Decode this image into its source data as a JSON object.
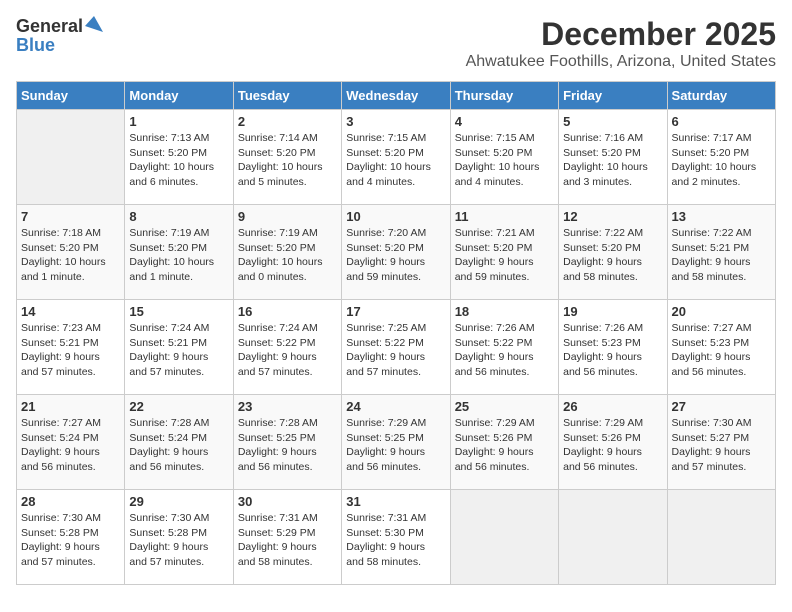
{
  "logo": {
    "general": "General",
    "blue": "Blue"
  },
  "header": {
    "month": "December 2025",
    "location": "Ahwatukee Foothills, Arizona, United States"
  },
  "weekdays": [
    "Sunday",
    "Monday",
    "Tuesday",
    "Wednesday",
    "Thursday",
    "Friday",
    "Saturday"
  ],
  "weeks": [
    [
      {
        "day": "",
        "info": ""
      },
      {
        "day": "1",
        "info": "Sunrise: 7:13 AM\nSunset: 5:20 PM\nDaylight: 10 hours\nand 6 minutes."
      },
      {
        "day": "2",
        "info": "Sunrise: 7:14 AM\nSunset: 5:20 PM\nDaylight: 10 hours\nand 5 minutes."
      },
      {
        "day": "3",
        "info": "Sunrise: 7:15 AM\nSunset: 5:20 PM\nDaylight: 10 hours\nand 4 minutes."
      },
      {
        "day": "4",
        "info": "Sunrise: 7:15 AM\nSunset: 5:20 PM\nDaylight: 10 hours\nand 4 minutes."
      },
      {
        "day": "5",
        "info": "Sunrise: 7:16 AM\nSunset: 5:20 PM\nDaylight: 10 hours\nand 3 minutes."
      },
      {
        "day": "6",
        "info": "Sunrise: 7:17 AM\nSunset: 5:20 PM\nDaylight: 10 hours\nand 2 minutes."
      }
    ],
    [
      {
        "day": "7",
        "info": "Sunrise: 7:18 AM\nSunset: 5:20 PM\nDaylight: 10 hours\nand 1 minute."
      },
      {
        "day": "8",
        "info": "Sunrise: 7:19 AM\nSunset: 5:20 PM\nDaylight: 10 hours\nand 1 minute."
      },
      {
        "day": "9",
        "info": "Sunrise: 7:19 AM\nSunset: 5:20 PM\nDaylight: 10 hours\nand 0 minutes."
      },
      {
        "day": "10",
        "info": "Sunrise: 7:20 AM\nSunset: 5:20 PM\nDaylight: 9 hours\nand 59 minutes."
      },
      {
        "day": "11",
        "info": "Sunrise: 7:21 AM\nSunset: 5:20 PM\nDaylight: 9 hours\nand 59 minutes."
      },
      {
        "day": "12",
        "info": "Sunrise: 7:22 AM\nSunset: 5:20 PM\nDaylight: 9 hours\nand 58 minutes."
      },
      {
        "day": "13",
        "info": "Sunrise: 7:22 AM\nSunset: 5:21 PM\nDaylight: 9 hours\nand 58 minutes."
      }
    ],
    [
      {
        "day": "14",
        "info": "Sunrise: 7:23 AM\nSunset: 5:21 PM\nDaylight: 9 hours\nand 57 minutes."
      },
      {
        "day": "15",
        "info": "Sunrise: 7:24 AM\nSunset: 5:21 PM\nDaylight: 9 hours\nand 57 minutes."
      },
      {
        "day": "16",
        "info": "Sunrise: 7:24 AM\nSunset: 5:22 PM\nDaylight: 9 hours\nand 57 minutes."
      },
      {
        "day": "17",
        "info": "Sunrise: 7:25 AM\nSunset: 5:22 PM\nDaylight: 9 hours\nand 57 minutes."
      },
      {
        "day": "18",
        "info": "Sunrise: 7:26 AM\nSunset: 5:22 PM\nDaylight: 9 hours\nand 56 minutes."
      },
      {
        "day": "19",
        "info": "Sunrise: 7:26 AM\nSunset: 5:23 PM\nDaylight: 9 hours\nand 56 minutes."
      },
      {
        "day": "20",
        "info": "Sunrise: 7:27 AM\nSunset: 5:23 PM\nDaylight: 9 hours\nand 56 minutes."
      }
    ],
    [
      {
        "day": "21",
        "info": "Sunrise: 7:27 AM\nSunset: 5:24 PM\nDaylight: 9 hours\nand 56 minutes."
      },
      {
        "day": "22",
        "info": "Sunrise: 7:28 AM\nSunset: 5:24 PM\nDaylight: 9 hours\nand 56 minutes."
      },
      {
        "day": "23",
        "info": "Sunrise: 7:28 AM\nSunset: 5:25 PM\nDaylight: 9 hours\nand 56 minutes."
      },
      {
        "day": "24",
        "info": "Sunrise: 7:29 AM\nSunset: 5:25 PM\nDaylight: 9 hours\nand 56 minutes."
      },
      {
        "day": "25",
        "info": "Sunrise: 7:29 AM\nSunset: 5:26 PM\nDaylight: 9 hours\nand 56 minutes."
      },
      {
        "day": "26",
        "info": "Sunrise: 7:29 AM\nSunset: 5:26 PM\nDaylight: 9 hours\nand 56 minutes."
      },
      {
        "day": "27",
        "info": "Sunrise: 7:30 AM\nSunset: 5:27 PM\nDaylight: 9 hours\nand 57 minutes."
      }
    ],
    [
      {
        "day": "28",
        "info": "Sunrise: 7:30 AM\nSunset: 5:28 PM\nDaylight: 9 hours\nand 57 minutes."
      },
      {
        "day": "29",
        "info": "Sunrise: 7:30 AM\nSunset: 5:28 PM\nDaylight: 9 hours\nand 57 minutes."
      },
      {
        "day": "30",
        "info": "Sunrise: 7:31 AM\nSunset: 5:29 PM\nDaylight: 9 hours\nand 58 minutes."
      },
      {
        "day": "31",
        "info": "Sunrise: 7:31 AM\nSunset: 5:30 PM\nDaylight: 9 hours\nand 58 minutes."
      },
      {
        "day": "",
        "info": ""
      },
      {
        "day": "",
        "info": ""
      },
      {
        "day": "",
        "info": ""
      }
    ]
  ]
}
